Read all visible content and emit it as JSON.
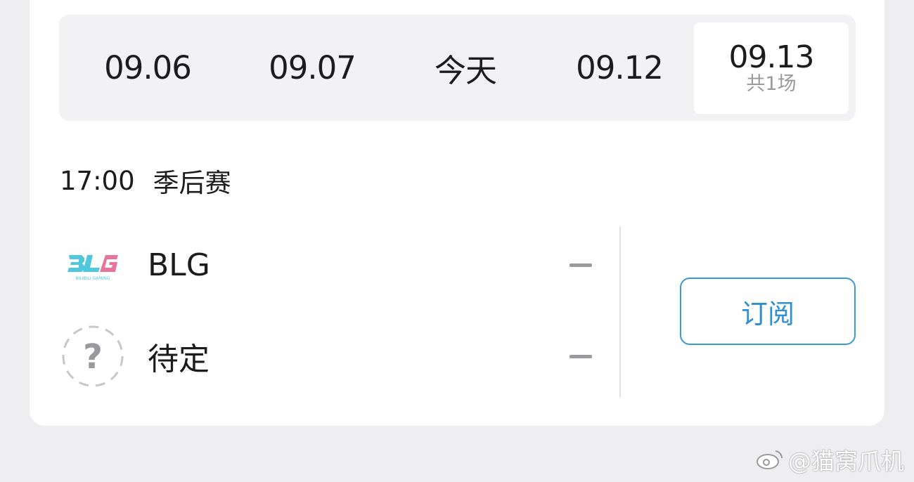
{
  "date_tabs": [
    {
      "label": "09.06",
      "count": ""
    },
    {
      "label": "09.07",
      "count": ""
    },
    {
      "label": "今天",
      "count": ""
    },
    {
      "label": "09.12",
      "count": ""
    },
    {
      "label": "09.13",
      "count": "共1场",
      "active": true
    }
  ],
  "match": {
    "time": "17:00",
    "stage": "季后赛",
    "teams": [
      {
        "name": "BLG",
        "score": "–",
        "logo_icon": "blg-logo",
        "logo_subtext": "BILIBILI GAMING"
      },
      {
        "name": "待定",
        "score": "–",
        "logo_icon": "question-mark-icon"
      }
    ],
    "subscribe_label": "订阅"
  },
  "watermark": "@猫窝爪机",
  "colors": {
    "accent": "#2f8fcf",
    "blg_cyan": "#4fc7df",
    "blg_pink": "#e8749a",
    "muted": "#9a9a9e"
  }
}
